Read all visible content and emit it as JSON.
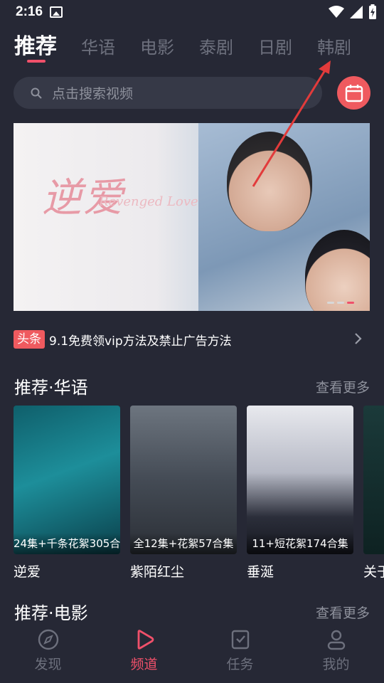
{
  "status": {
    "time": "2:16"
  },
  "tabs": [
    {
      "label": "推荐"
    },
    {
      "label": "华语"
    },
    {
      "label": "电影"
    },
    {
      "label": "泰剧"
    },
    {
      "label": "日剧"
    },
    {
      "label": "韩剧"
    }
  ],
  "search": {
    "placeholder": "点击搜索视频"
  },
  "banner": {
    "title": "逆爱",
    "subtitle": "Revenged Love"
  },
  "notice": {
    "badge": "头条",
    "text": "9.1免费领vip方法及禁止广告方法"
  },
  "section1": {
    "title": "推荐·华语",
    "more": "查看更多",
    "items": [
      {
        "caption": "24集+千条花絮305合集",
        "title": "逆爱"
      },
      {
        "caption": "全12集+花絮57合集",
        "title": "紫陌红尘"
      },
      {
        "caption": "11+短花絮174合集",
        "title": "垂涎"
      },
      {
        "caption": "",
        "title": "关于"
      }
    ]
  },
  "section2": {
    "title": "推荐·电影",
    "more": "查看更多"
  },
  "nav": [
    {
      "label": "发现"
    },
    {
      "label": "频道"
    },
    {
      "label": "任务"
    },
    {
      "label": "我的"
    }
  ],
  "colors": {
    "accent": "#f0506a",
    "background": "#262835",
    "calendar": "#ef5a5f"
  }
}
